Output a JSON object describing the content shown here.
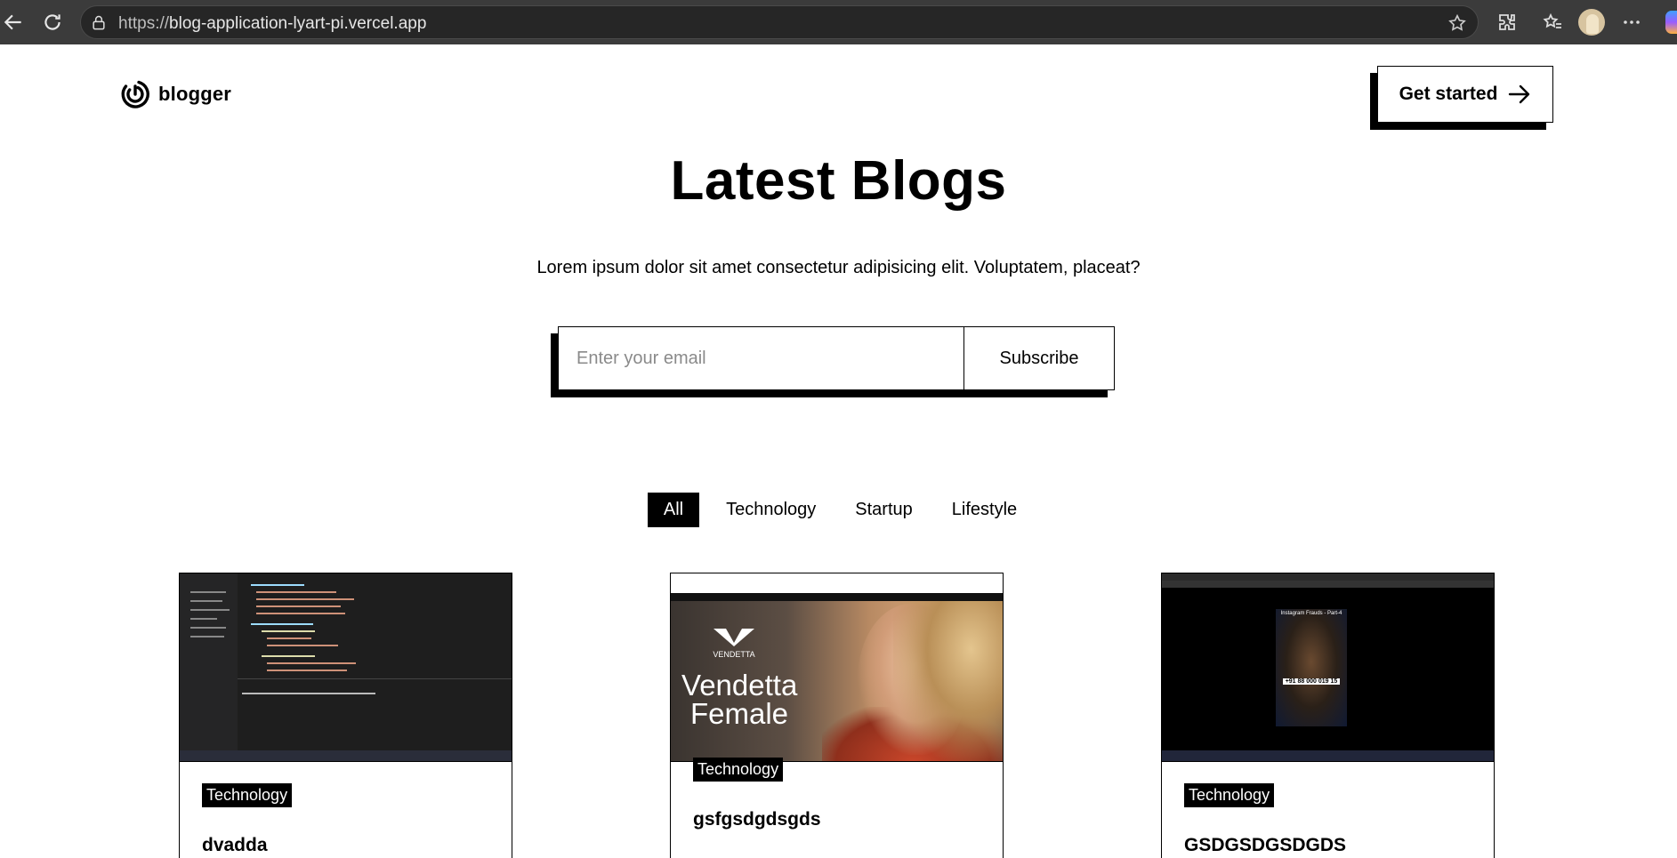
{
  "browser": {
    "url_prefix": "https://",
    "url_host": "blog-application-lyart-pi.vercel.app"
  },
  "header": {
    "brand": "blogger",
    "cta_label": "Get started"
  },
  "hero": {
    "title": "Latest Blogs",
    "subtitle": "Lorem ipsum dolor sit amet consectetur adipisicing elit. Voluptatem, placeat?"
  },
  "subscribe": {
    "placeholder": "Enter your email",
    "value": "",
    "button_label": "Subscribe"
  },
  "filters": [
    {
      "label": "All",
      "active": true
    },
    {
      "label": "Technology",
      "active": false
    },
    {
      "label": "Startup",
      "active": false
    },
    {
      "label": "Lifestyle",
      "active": false
    }
  ],
  "thumb_text": {
    "shop_banner": "Vendetta Female",
    "shop_logo": "VENDETTA",
    "reel_title": "Instagram Frauds - Part-4",
    "reel_phone": "+91 88 000 019 15"
  },
  "cards": [
    {
      "category": "Technology",
      "title": "dvadda",
      "thumb": "code-editor-screenshot"
    },
    {
      "category": "Technology",
      "title": "gsfgsdgdsgds",
      "thumb": "fashion-store-screenshot"
    },
    {
      "category": "Technology",
      "title": "GSDGSDGSDGDS",
      "thumb": "instagram-screenshot"
    }
  ],
  "colors": {
    "accent": "#000000",
    "background": "#ffffff",
    "browser_chrome": "#3b3b3b"
  }
}
